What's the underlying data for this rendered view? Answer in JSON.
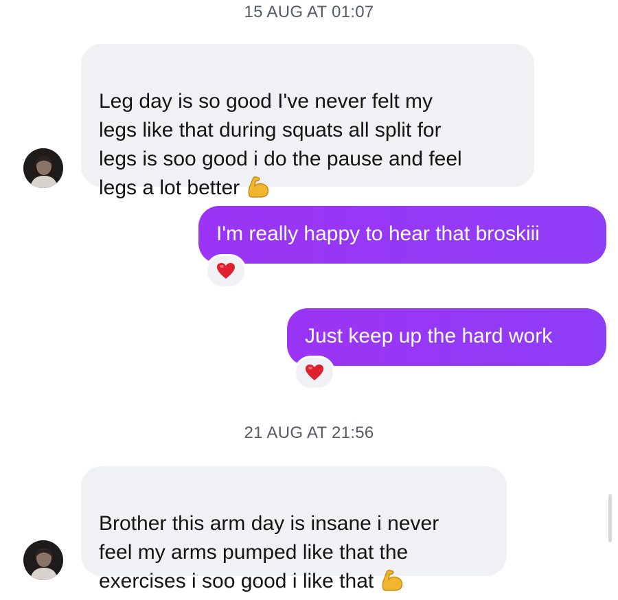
{
  "thread": {
    "timestamp_1": "15 AUG AT 01:07",
    "timestamp_2": "21 AUG AT 21:56",
    "messages": [
      {
        "direction": "incoming",
        "text": "Leg day is so good I've never felt my\nlegs like that during squats all split for\nlegs is soo good i do the pause and feel\nlegs a lot better",
        "emoji": "flexed-biceps"
      },
      {
        "direction": "outgoing",
        "text": "I'm really happy to hear that broskiii",
        "reaction": "❤️"
      },
      {
        "direction": "outgoing",
        "text": "Just keep up the hard work",
        "reaction": "❤️"
      },
      {
        "direction": "incoming",
        "text": "Brother this arm day is insane i never\nfeel my arms pumped like that the\nexercises i soo good i like that",
        "emoji": "flexed-biceps"
      }
    ]
  },
  "colors": {
    "outgoing_bubble": "#9b34f4",
    "incoming_bubble": "#f0f1f5",
    "timestamp_text": "#555b66",
    "heart": "#e0202e"
  },
  "icons": {
    "avatar": "avatar-icon",
    "biceps": "flexed-biceps-icon",
    "heart": "red-heart-icon"
  }
}
